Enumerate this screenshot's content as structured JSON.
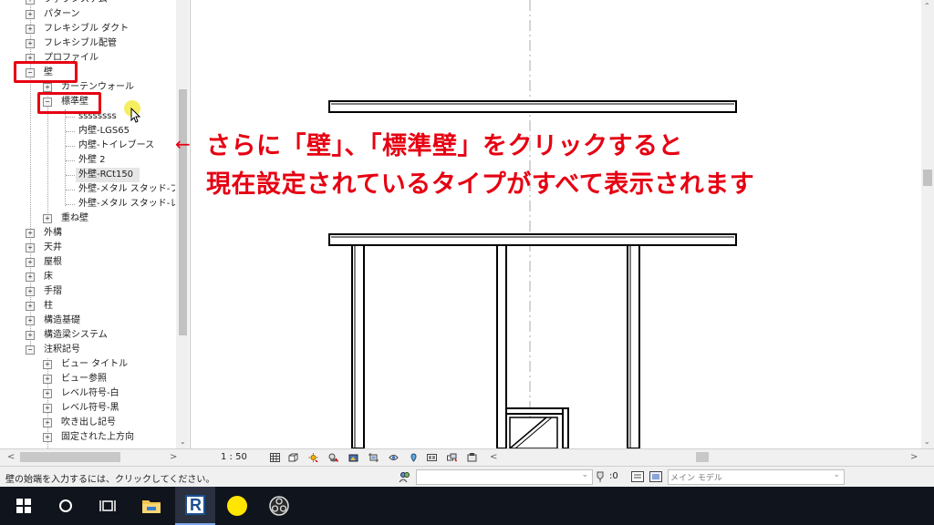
{
  "tree": {
    "items": [
      {
        "label": "ファブシステム",
        "expander": "+"
      },
      {
        "label": "パターン",
        "expander": "+"
      },
      {
        "label": "フレキシブル ダクト",
        "expander": "+"
      },
      {
        "label": "フレキシブル配管",
        "expander": "+"
      },
      {
        "label": "プロファイル",
        "expander": "+"
      },
      {
        "label": "壁",
        "expander": "−"
      },
      {
        "label": "カーテンウォール",
        "expander": "+"
      },
      {
        "label": "標準壁",
        "expander": "−"
      },
      {
        "label": "ssssssss"
      },
      {
        "label": "内壁-LGS65"
      },
      {
        "label": "内壁-トイレブース"
      },
      {
        "label": "外壁 2"
      },
      {
        "label": "外壁-RCt150"
      },
      {
        "label": "外壁-メタル スタッド-ブ"
      },
      {
        "label": "外壁-メタル スタッド-レ"
      },
      {
        "label": "重ね壁",
        "expander": "+"
      },
      {
        "label": "外構",
        "expander": "+"
      },
      {
        "label": "天井",
        "expander": "+"
      },
      {
        "label": "屋根",
        "expander": "+"
      },
      {
        "label": "床",
        "expander": "+"
      },
      {
        "label": "手摺",
        "expander": "+"
      },
      {
        "label": "柱",
        "expander": "+"
      },
      {
        "label": "構造基礎",
        "expander": "+"
      },
      {
        "label": "構造梁システム",
        "expander": "+"
      },
      {
        "label": "注釈記号",
        "expander": "−"
      },
      {
        "label": "ビュー タイトル",
        "expander": "+"
      },
      {
        "label": "ビュー参照",
        "expander": "+"
      },
      {
        "label": "レベル符号-白",
        "expander": "+"
      },
      {
        "label": "レベル符号-黒",
        "expander": "+"
      },
      {
        "label": "吹き出し記号",
        "expander": "+"
      },
      {
        "label": "固定された上方向",
        "expander": "+"
      }
    ]
  },
  "annotation": {
    "arrow": "←",
    "line1": "さらに「壁」、「標準壁」をクリックすると",
    "line2": "現在設定されているタイプがすべて表示されます"
  },
  "viewbar": {
    "scale": "1 : 50",
    "zero": ":0"
  },
  "statusbar": {
    "hint": "壁の始端を入力するには、クリックしてください。",
    "model": "メイン モデル"
  },
  "colors": {
    "annotation_red": "#e60012",
    "taskbar": "#10141c"
  },
  "icons": {
    "start": "windows-icon",
    "search": "cortana-circle-icon",
    "task_view": "task-view-icon",
    "explorer": "file-explorer-icon",
    "revit": "revit-icon",
    "circle": "yellow-circle-icon",
    "obs": "obs-icon"
  },
  "taskbar": {
    "revit_letter": "R"
  }
}
